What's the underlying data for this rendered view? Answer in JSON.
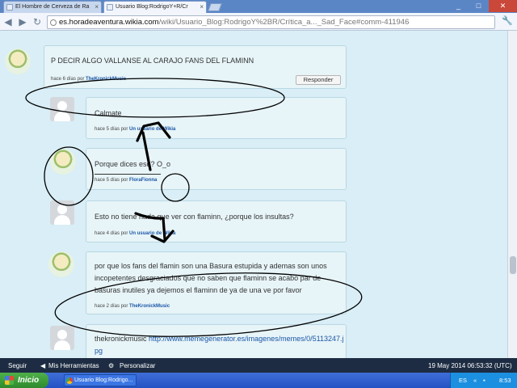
{
  "browser": {
    "tabs": [
      {
        "label": "El Hombre de Cerveza de Ra",
        "active": false
      },
      {
        "label": "Usuario Blog:RodrigoY+R/Cr",
        "active": true
      }
    ],
    "url_host": "es.horadeaventura.wikia.com",
    "url_path": "/wiki/Usuario_Blog:RodrigoY%2BR/Crítica_a..._Sad_Face#comm-411946"
  },
  "comments": [
    {
      "avatar": "character",
      "text": "P DECIR ALGO VALLANSE AL CARAJO FANS DEL FLAMINN",
      "time": "hace 6 días por",
      "author": "TheKronickMusic",
      "reply_label": "Responder"
    },
    {
      "avatar": "default",
      "text": "Calmate",
      "time": "hace 5 días por",
      "author": "Un usuario de Wikia"
    },
    {
      "avatar": "character",
      "text": "Porque dices eso? O_o",
      "time": "hace 5 días por",
      "author": "FloraFionna"
    },
    {
      "avatar": "default",
      "text": "Esto no tiene nada que ver con flaminn, ¿porque los insultas?",
      "time": "hace 4 días por",
      "author": "Un usuario de Wikia"
    },
    {
      "avatar": "character",
      "text": "por que los fans del flamin son una Basura estupida y ademas son unos incopetentes desgraciados que no saben que flaminn se acabo par de basuras inutiles ya dejemos el flaminn de ya de una ve por favor",
      "time": "hace 2 días por",
      "author": "TheKronickMusic"
    },
    {
      "avatar": "default",
      "text_prefix": "thekronickmusic",
      "link": "http://www.memegenerator.es/imagenes/memes/0/5113247.jpg",
      "link_line1": "http://www.memegenerator.es/imagenes/memes/0/5113247.j",
      "link_line2": "pg"
    }
  ],
  "wikia_toolbar": {
    "follow": "Seguir",
    "my_tools": "Mis Herramientas",
    "customize": "Personalizar",
    "timestamp": "19 May 2014 06:53:32 (UTC)"
  },
  "taskbar": {
    "start": "Inicio",
    "task": "Usuario Blog:Rodrigo...",
    "lang": "ES",
    "clock": "8:53"
  },
  "colors": {
    "page_bg": "#d9eef6",
    "comment_bg": "#e7f4f8",
    "link": "#1b56a6",
    "annotation": "#000000"
  }
}
